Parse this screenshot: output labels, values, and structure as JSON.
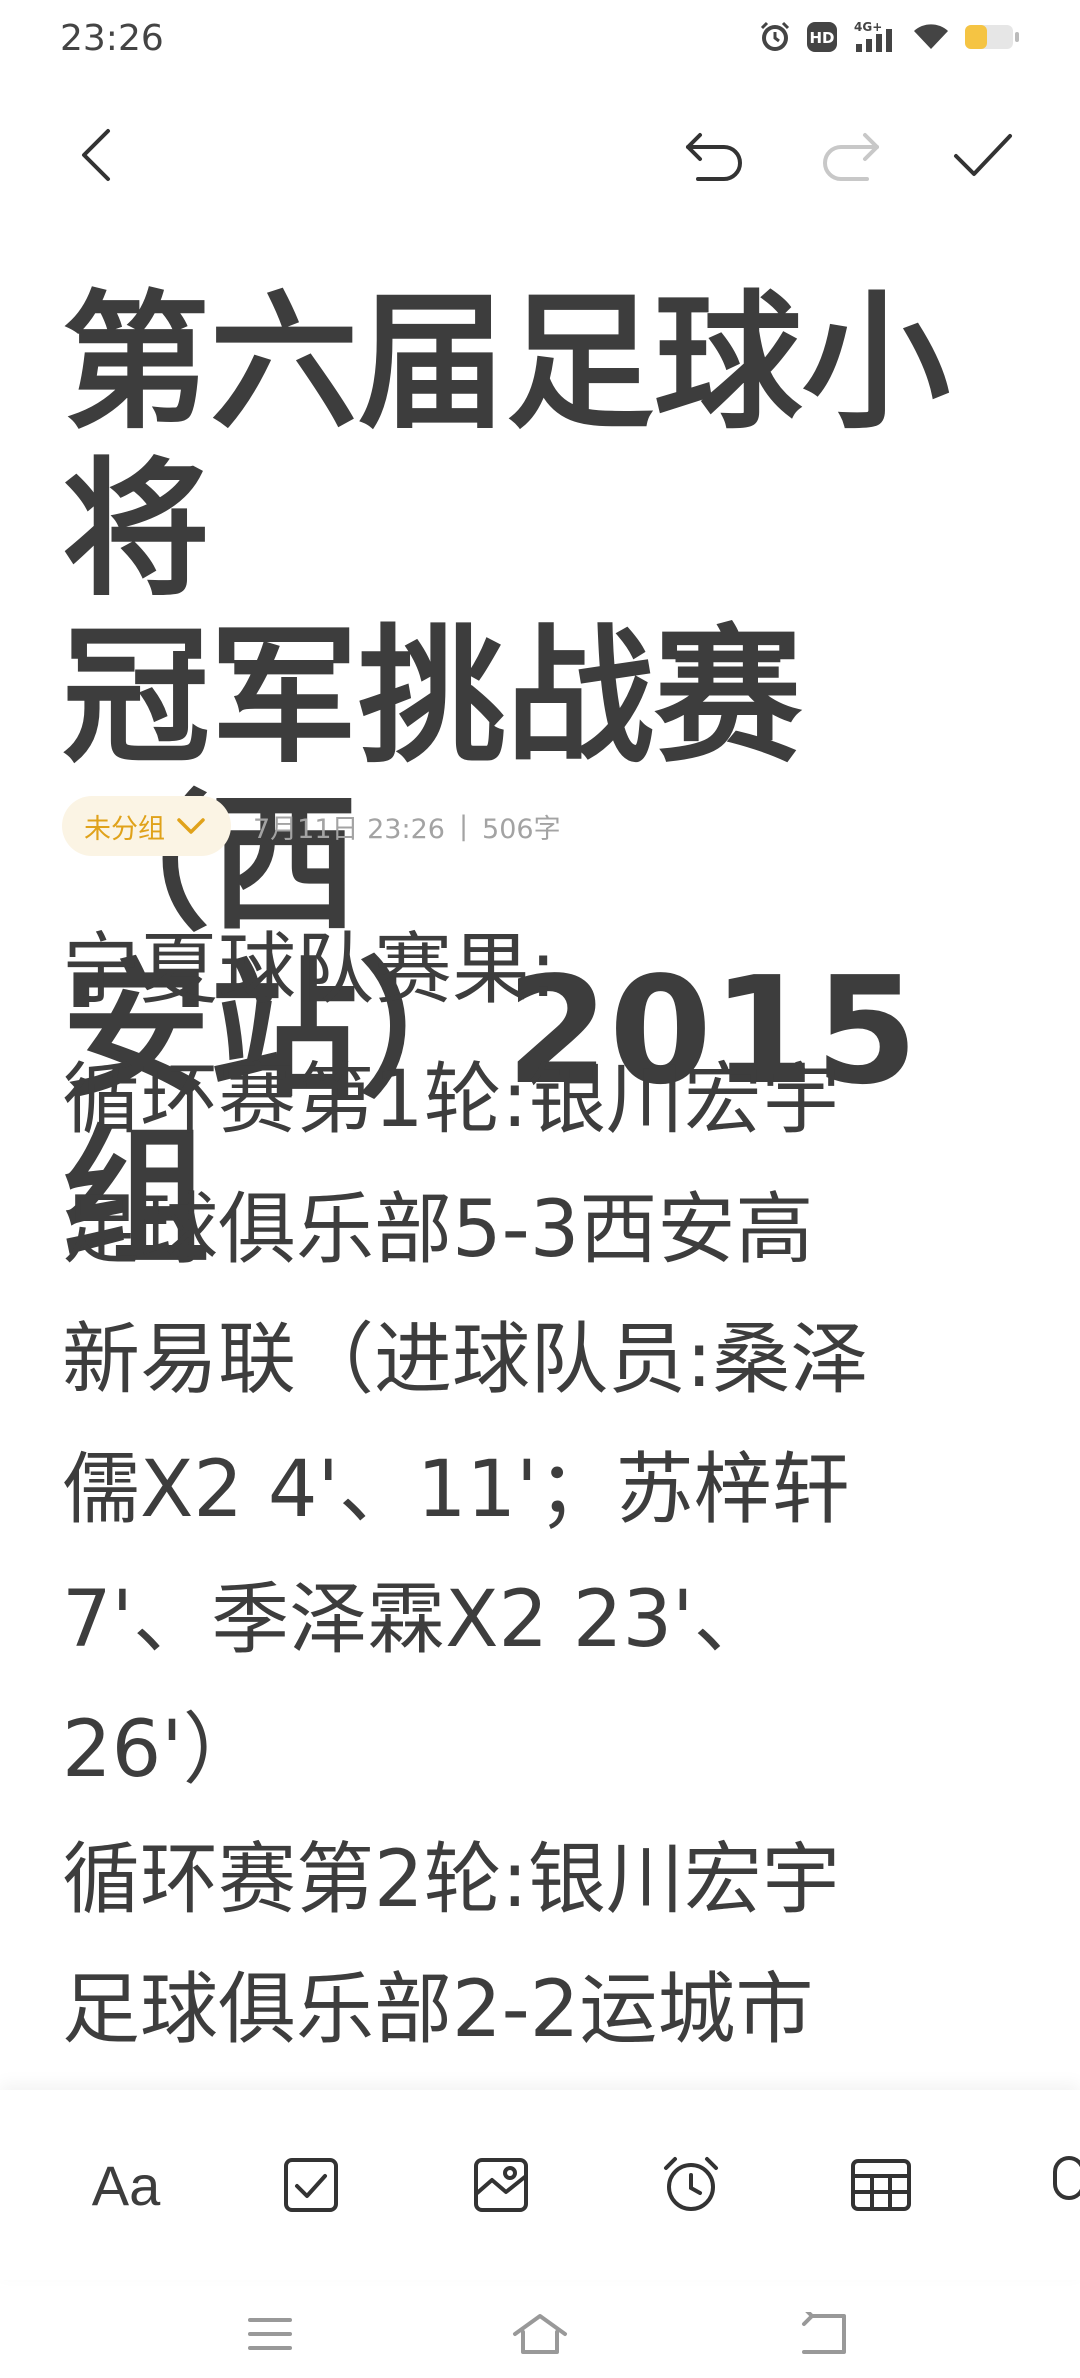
{
  "status_bar": {
    "time": "23:26",
    "icons": [
      "alarm-icon",
      "hd-icon",
      "signal-4g-icon",
      "wifi-icon",
      "battery-icon"
    ],
    "hd_label": "HD",
    "network_label": "4G+"
  },
  "toolbar": {
    "icons": [
      "back-arrow-icon",
      "undo-icon",
      "redo-icon",
      "check-icon"
    ]
  },
  "note": {
    "title_lines": [
      "第六届足球小将",
      "冠军挑战赛（西",
      "安站）2015组"
    ],
    "group_label": "未分组",
    "date": "7月11日 23:26",
    "separator": "|",
    "word_count": "506字",
    "body_lines": [
      "宁夏球队赛果:",
      "循环赛第1轮:银川宏宇",
      "足球俱乐部5-3西安高",
      "新易联（进球队员:桑泽",
      "儒X2 4'、11'；苏梓轩",
      "7'、季泽霖X2 23'、",
      "26'）",
      "循环赛第2轮:银川宏宇",
      "足球俱乐部2-2运城市"
    ]
  },
  "format_bar": {
    "text_style_label": "Aa",
    "icons": [
      "checkbox-icon",
      "image-icon",
      "alarm-clock-icon",
      "table-icon",
      "microphone-icon"
    ]
  },
  "nav_bar": {
    "icons": [
      "menu-icon",
      "home-icon",
      "back-icon"
    ]
  },
  "colors": {
    "accent": "#e0a21a",
    "chip_bg": "#fbf4e4",
    "text": "#3d3d3d",
    "muted": "#a3a3a3",
    "battery": "#f5c443"
  }
}
